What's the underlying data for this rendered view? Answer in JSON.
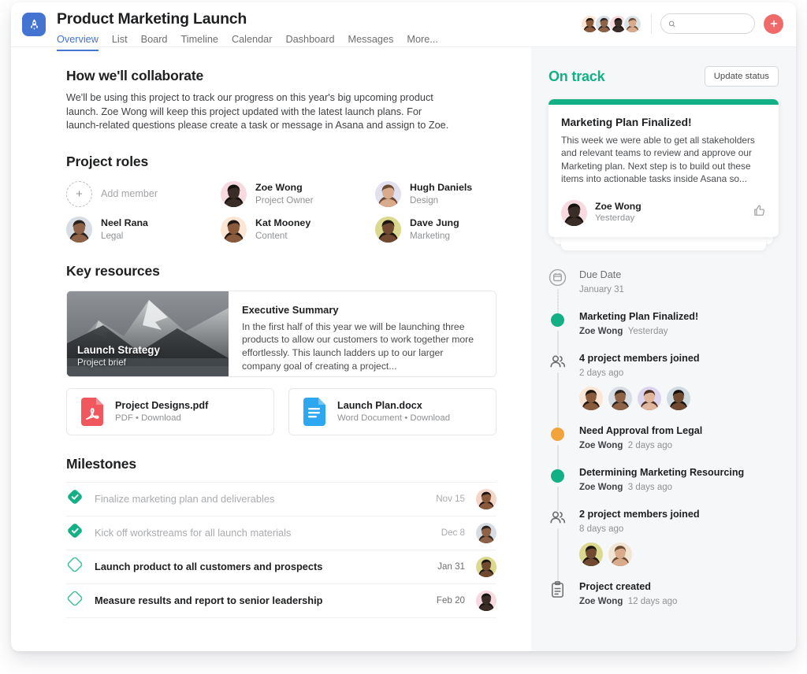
{
  "header": {
    "app_icon": "rocket-icon",
    "title": "Product Marketing Launch",
    "tabs": [
      {
        "label": "Overview",
        "active": true
      },
      {
        "label": "List",
        "active": false
      },
      {
        "label": "Board",
        "active": false
      },
      {
        "label": "Timeline",
        "active": false
      },
      {
        "label": "Calendar",
        "active": false
      },
      {
        "label": "Dashboard",
        "active": false
      },
      {
        "label": "Messages",
        "active": false
      },
      {
        "label": "More...",
        "active": false
      }
    ],
    "search": {
      "value": "",
      "placeholder": "",
      "icon": "search-icon"
    },
    "add_button": {
      "label": "+",
      "icon": "plus-icon",
      "color": "#f06a6a"
    },
    "member_avatars": [
      "#f3d9d2",
      "#ccd4da",
      "#f0d5dd",
      "#dbe2e6"
    ]
  },
  "main": {
    "collaborate": {
      "heading": "How we'll collaborate",
      "body": "We'll be using this project to track our progress on this year's big upcoming product launch. Zoe Wong will keep this project updated with the latest launch plans. For launch-related questions please create a task or message in Asana and assign to Zoe."
    },
    "roles": {
      "heading": "Project roles",
      "add_member_label": "Add member",
      "members": [
        {
          "name": "Zoe Wong",
          "role": "Project Owner",
          "bg": "#f7d9e0",
          "skin": "#3a2c26",
          "hair": "#16130f"
        },
        {
          "name": "Hugh Daniels",
          "role": "Design",
          "bg": "#e2e0ef",
          "skin": "#d8ab8d",
          "hair": "#6b4a32"
        },
        {
          "name": "Neel Rana",
          "role": "Legal",
          "bg": "#d7dde2",
          "skin": "#8d6246",
          "hair": "#2a2320"
        },
        {
          "name": "Kat Mooney",
          "role": "Content",
          "bg": "#fbe6d5",
          "skin": "#8a5a3c",
          "hair": "#201713"
        },
        {
          "name": "Dave Jung",
          "role": "Marketing",
          "bg": "#dbd98f",
          "skin": "#6f4930",
          "hair": "#1d1713"
        }
      ]
    },
    "resources": {
      "heading": "Key resources",
      "brief": {
        "overlay_title": "Launch Strategy",
        "overlay_sub": "Project brief",
        "title": "Executive Summary",
        "body": "In the first half of this year we will be launching three products to allow our customers to work together more effortlessly. This launch ladders up to our larger company goal of creating a project..."
      },
      "files": [
        {
          "name": "Project Designs.pdf",
          "meta": "PDF • Download",
          "icon": "pdf-file-icon",
          "color": "#f0585d"
        },
        {
          "name": "Launch Plan.docx",
          "meta": "Word Document • Download",
          "icon": "word-file-icon",
          "color": "#2ca7f0"
        }
      ]
    },
    "milestones": {
      "heading": "Milestones",
      "items": [
        {
          "label": "Finalize marketing plan and deliverables",
          "date": "Nov 15",
          "done": true,
          "icon": "milestone-complete-icon",
          "bg": "#f4d6c8",
          "skin": "#8b5a3c",
          "hair": "#1d1512"
        },
        {
          "label": "Kick off workstreams for all launch materials",
          "date": "Dec 8",
          "done": true,
          "icon": "milestone-complete-icon",
          "bg": "#d7dde2",
          "skin": "#8d6246",
          "hair": "#2a2320"
        },
        {
          "label": "Launch product to all customers and prospects",
          "date": "Jan 31",
          "done": false,
          "icon": "milestone-incomplete-icon",
          "bg": "#dbd98f",
          "skin": "#6f4930",
          "hair": "#1d1713"
        },
        {
          "label": "Measure results and report to senior leadership",
          "date": "Feb 20",
          "done": false,
          "icon": "milestone-incomplete-icon",
          "bg": "#f7d9e0",
          "skin": "#3a2c26",
          "hair": "#16130f"
        }
      ]
    }
  },
  "sidebar": {
    "status_label": "On track",
    "status_color": "#14b085",
    "update_button": "Update status",
    "status_card": {
      "headline": "Marketing Plan Finalized!",
      "body": "This week we were able to get all stakeholders and relevant teams to review and approve our Marketing plan. Next step is to build out these items into actionable tasks inside Asana so...",
      "author": "Zoe Wong",
      "time": "Yesterday",
      "like_icon": "thumbs-up-icon"
    },
    "timeline": [
      {
        "marker": "calendar-icon",
        "title": "Due Date",
        "muted": true,
        "sub": "January 31",
        "author": "",
        "line": "dotted"
      },
      {
        "marker": "dot",
        "dot_color": "#14b085",
        "title": "Marketing Plan Finalized!",
        "author": "Zoe Wong",
        "sub": "Yesterday",
        "line": "solid"
      },
      {
        "marker": "people-icon",
        "title": "4 project members joined",
        "author": "",
        "sub": "2 days ago",
        "line": "solid",
        "avatars": [
          {
            "bg": "#fbe6d5",
            "skin": "#8a5a3c",
            "hair": "#201713"
          },
          {
            "bg": "#d7dde2",
            "skin": "#8d6246",
            "hair": "#2a2320"
          },
          {
            "bg": "#ddd5ef",
            "skin": "#e0b69a",
            "hair": "#4a2f22"
          },
          {
            "bg": "#cfdbe0",
            "skin": "#6f4930",
            "hair": "#17120f"
          }
        ]
      },
      {
        "marker": "dot",
        "dot_color": "#f2a33c",
        "title": "Need Approval from Legal",
        "author": "Zoe Wong",
        "sub": "2 days ago",
        "line": "solid"
      },
      {
        "marker": "dot",
        "dot_color": "#14b085",
        "title": "Determining Marketing Resourcing",
        "author": "Zoe Wong",
        "sub": "3 days ago",
        "line": "solid"
      },
      {
        "marker": "people-icon",
        "title": "2 project members joined",
        "author": "",
        "sub": "8 days ago",
        "line": "solid",
        "avatars": [
          {
            "bg": "#dbd98f",
            "skin": "#6f4930",
            "hair": "#1d1713"
          },
          {
            "bg": "#f1e4d2",
            "skin": "#d8ab8d",
            "hair": "#6b4a32"
          }
        ]
      },
      {
        "marker": "clipboard-icon",
        "title": "Project created",
        "author": "Zoe Wong",
        "sub": "12 days ago",
        "line": "none"
      }
    ]
  }
}
